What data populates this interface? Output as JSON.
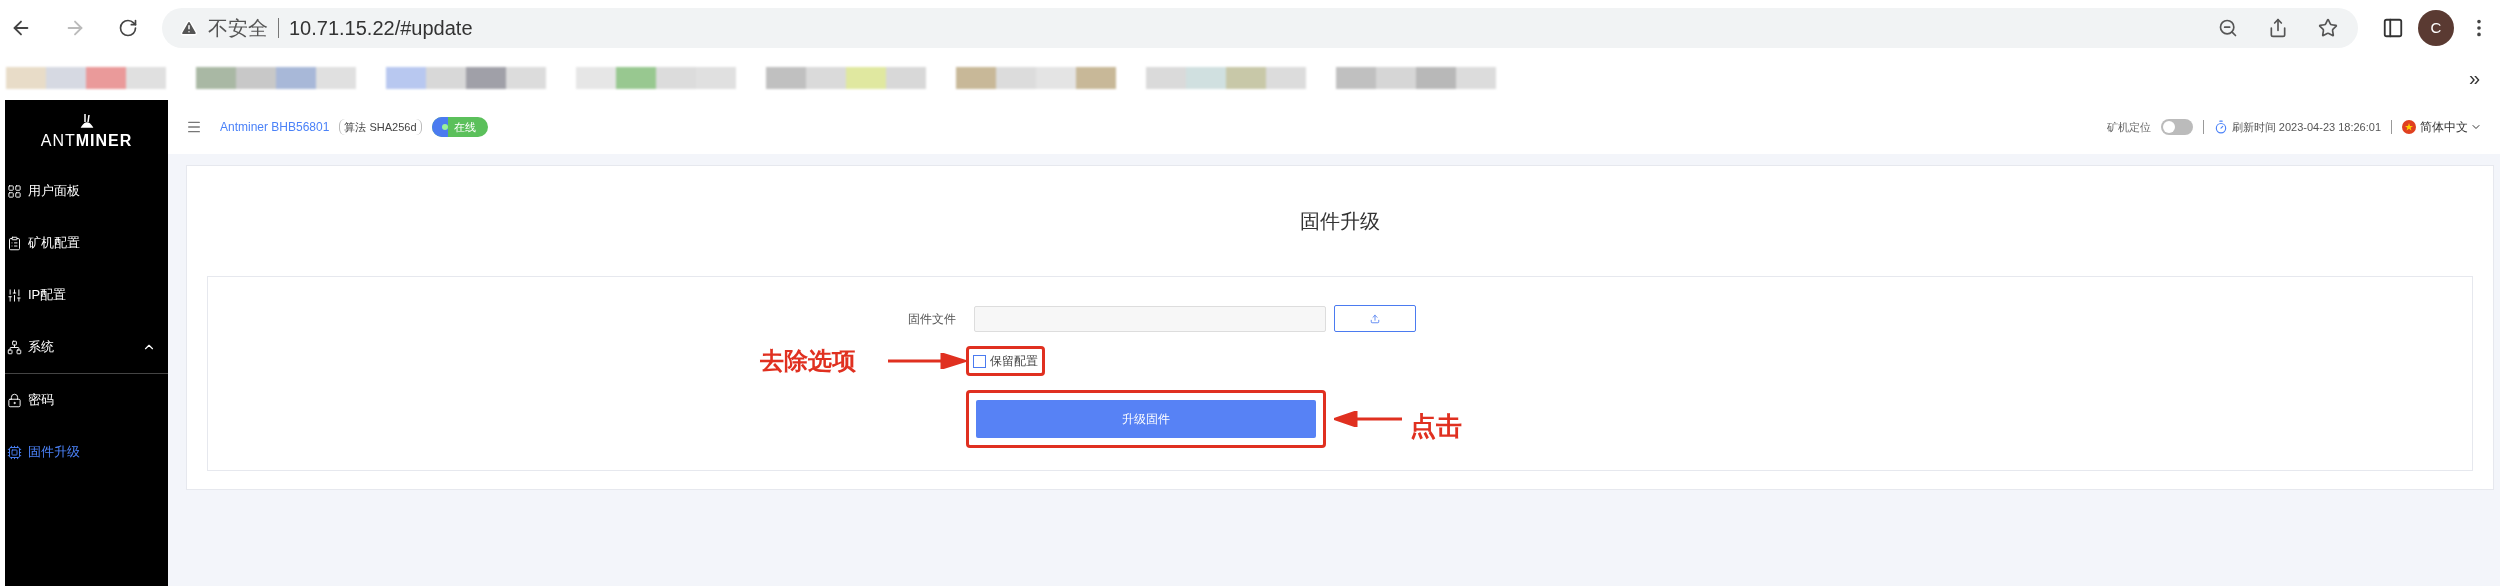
{
  "browser": {
    "security_label": "不安全",
    "url": "10.71.15.22/#update",
    "profile_initial": "C",
    "bookmarks_overflow": "»"
  },
  "sidebar": {
    "logo": {
      "prefix": "ANT",
      "suffix": "MINER"
    },
    "items": [
      {
        "label": "用户面板",
        "kind": "grid",
        "selected": false
      },
      {
        "label": "矿机配置",
        "kind": "device",
        "selected": false
      },
      {
        "label": "IP配置",
        "kind": "sliders",
        "selected": false
      },
      {
        "label": "系统",
        "kind": "network",
        "selected": false,
        "expanded": true,
        "children": [
          {
            "label": "密码",
            "kind": "lock",
            "selected": false
          },
          {
            "label": "固件升级",
            "kind": "chip",
            "selected": true
          }
        ]
      }
    ]
  },
  "header": {
    "miner_name": "Antminer BHB56801",
    "algorithm": "算法 SHA256d",
    "status": {
      "label": "在线",
      "on": true
    },
    "locate": {
      "label": "矿机定位",
      "on": false
    },
    "refresh": "刷新时间 2023-04-23 18:26:01",
    "language": "简体中文"
  },
  "page": {
    "title": "固件升级",
    "file_label": "固件文件",
    "keep_config": {
      "label": "保留配置",
      "checked": false
    },
    "submit": "升级固件"
  },
  "annotations": {
    "checkbox_note": "去除选项",
    "button_note": "点击"
  }
}
